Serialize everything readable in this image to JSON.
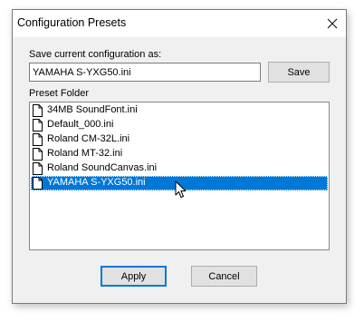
{
  "window": {
    "title": "Configuration Presets",
    "close_icon": "close-icon"
  },
  "save_section": {
    "label": "Save current configuration as:",
    "filename_value": "YAMAHA S-YXG50.ini",
    "save_button_label": "Save"
  },
  "preset_folder": {
    "label": "Preset Folder",
    "items": [
      {
        "name": "34MB SoundFont.ini",
        "icon": "file-icon",
        "selected": false
      },
      {
        "name": "Default_000.ini",
        "icon": "file-icon",
        "selected": false
      },
      {
        "name": "Roland CM-32L.ini",
        "icon": "file-icon",
        "selected": false
      },
      {
        "name": "Roland MT-32.ini",
        "icon": "file-icon",
        "selected": false
      },
      {
        "name": "Roland SoundCanvas.ini",
        "icon": "file-icon",
        "selected": false
      },
      {
        "name": "YAMAHA S-YXG50.ini",
        "icon": "file-icon",
        "selected": true
      }
    ]
  },
  "buttons": {
    "apply_label": "Apply",
    "cancel_label": "Cancel"
  },
  "colors": {
    "selection": "#0078d7",
    "dialog_background": "#f0f0f0"
  }
}
